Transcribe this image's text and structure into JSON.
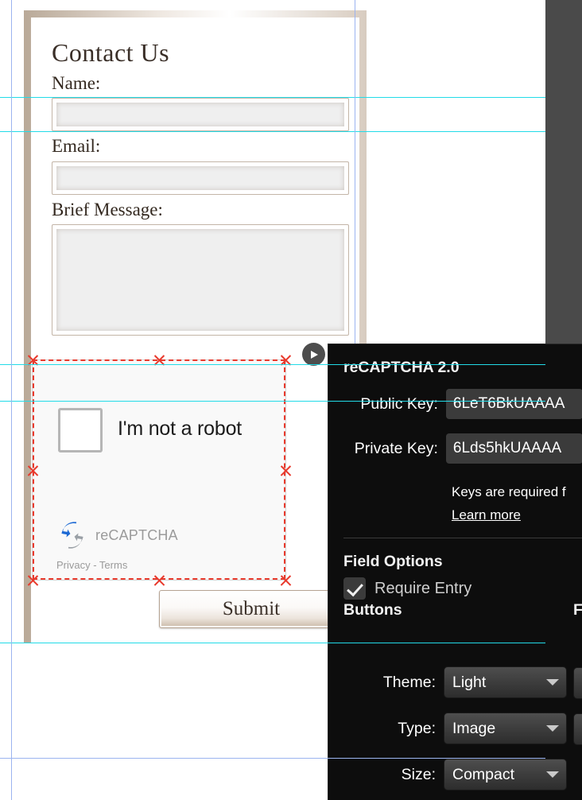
{
  "form": {
    "title": "Contact Us",
    "fields": [
      {
        "label": "Name:",
        "value": ""
      },
      {
        "label": "Email:",
        "value": ""
      },
      {
        "label": "Brief Message:",
        "value": ""
      }
    ],
    "submit_label": "Submit"
  },
  "recaptcha_widget": {
    "checkbox_label": "I'm not a robot",
    "brand": "reCAPTCHA",
    "terms": "Privacy - Terms",
    "checked": false
  },
  "panel": {
    "heading": "reCAPTCHA 2.0",
    "public_key": {
      "label": "Public Key:",
      "value": "6LeT6BkUAAAA"
    },
    "private_key": {
      "label": "Private Key:",
      "value": "6Lds5hkUAAAA"
    },
    "hint": "Keys are required f",
    "learn_more": "Learn more",
    "field_options": {
      "heading": "Field Options",
      "require_entry_label": "Require Entry",
      "require_entry_checked": true
    },
    "buttons": {
      "heading": "Buttons",
      "right_column_heading": "F",
      "rows": [
        {
          "label": "Theme:",
          "value": "Light"
        },
        {
          "label": "Type:",
          "value": "Image"
        },
        {
          "label": "Size:",
          "value": "Compact"
        }
      ]
    }
  },
  "icons": {
    "play": "play-icon",
    "caret": "chevron-down-icon",
    "recaptcha_logo": "recaptcha-logo-icon"
  },
  "colors": {
    "panel_bg": "#0d0d0d",
    "guide_cyan": "#22dbe8",
    "guide_blue": "#9bb4f0",
    "selection_red": "#e8392c",
    "gutter": "#4a4a4a"
  }
}
